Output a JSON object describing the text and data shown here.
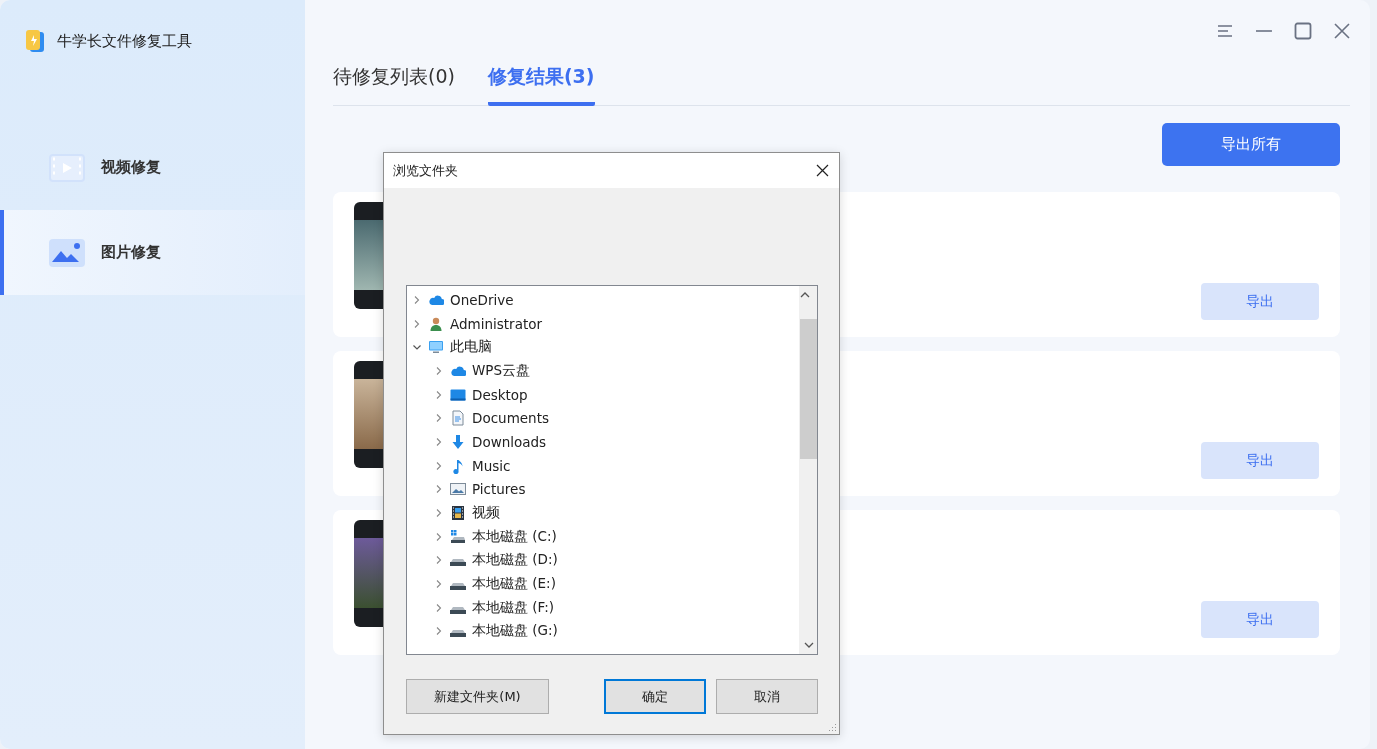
{
  "app": {
    "title": "牛学长文件修复工具"
  },
  "sidebar": {
    "items": [
      {
        "label": "视频修复",
        "kind": "video",
        "selected": false
      },
      {
        "label": "图片修复",
        "kind": "image",
        "selected": true
      }
    ]
  },
  "tabs": [
    {
      "label": "待修复列表(0)",
      "selected": false
    },
    {
      "label": "修复结果(3)",
      "selected": true
    }
  ],
  "export_all_button": "导出所有",
  "results": [
    {
      "button": "导出"
    },
    {
      "button": "导出"
    },
    {
      "button": "导出"
    }
  ],
  "dialog": {
    "title": "浏览文件夹",
    "tree": [
      {
        "label": "OneDrive",
        "kind": "cloud",
        "expanded": false
      },
      {
        "label": "Administrator",
        "kind": "user",
        "expanded": false
      },
      {
        "label": "此电脑",
        "kind": "computer",
        "expanded": true,
        "children": [
          {
            "label": "WPS云盘",
            "kind": "cloud",
            "expanded": false
          },
          {
            "label": "Desktop",
            "kind": "desktop",
            "expanded": false
          },
          {
            "label": "Documents",
            "kind": "document",
            "expanded": false
          },
          {
            "label": "Downloads",
            "kind": "download",
            "expanded": false
          },
          {
            "label": "Music",
            "kind": "music",
            "expanded": false
          },
          {
            "label": "Pictures",
            "kind": "pictures",
            "expanded": false
          },
          {
            "label": "视频",
            "kind": "video",
            "expanded": false
          },
          {
            "label": "本地磁盘 (C:)",
            "kind": "system-drive",
            "expanded": false
          },
          {
            "label": "本地磁盘 (D:)",
            "kind": "drive",
            "expanded": false
          },
          {
            "label": "本地磁盘 (E:)",
            "kind": "drive",
            "expanded": false
          },
          {
            "label": "本地磁盘 (F:)",
            "kind": "drive",
            "expanded": false
          },
          {
            "label": "本地磁盘 (G:)",
            "kind": "drive",
            "expanded": false
          }
        ]
      }
    ],
    "buttons": [
      {
        "label": "新建文件夹(M)",
        "default": false
      },
      {
        "label": "确定",
        "default": true
      },
      {
        "label": "取消",
        "default": false
      }
    ]
  }
}
